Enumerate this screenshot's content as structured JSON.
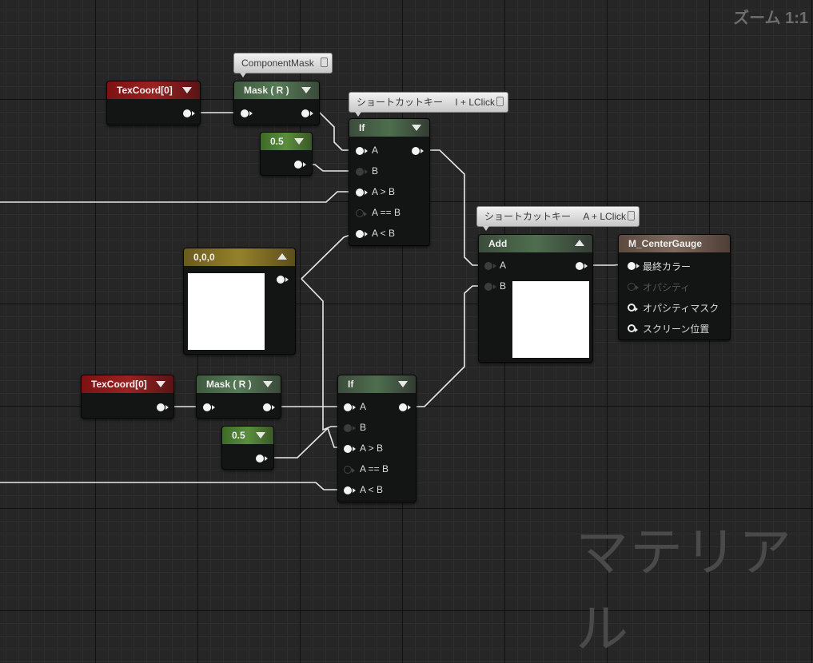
{
  "zoom_label": "ズーム 1:1",
  "watermark": "マテリアル",
  "comments": {
    "component_mask": "ComponentMask",
    "shortcut_if": "ショートカットキー　 I + LClick",
    "shortcut_add": "ショートカットキー　 A + LClick"
  },
  "nodes": {
    "texcoord_top": {
      "title": "TexCoord[0]"
    },
    "mask_top": {
      "title": "Mask ( R )"
    },
    "const_top": {
      "title": "0.5"
    },
    "if_top": {
      "title": "If",
      "pins": [
        "A",
        "B",
        "A > B",
        "A == B",
        "A < B"
      ]
    },
    "vector_const": {
      "title": "0,0,0"
    },
    "add": {
      "title": "Add",
      "pins": [
        "A",
        "B"
      ]
    },
    "material_output": {
      "title": "M_CenterGauge",
      "pins": [
        "最終カラー",
        "オパシティ",
        "オパシティマスク",
        "スクリーン位置"
      ]
    },
    "texcoord_bottom": {
      "title": "TexCoord[0]"
    },
    "mask_bottom": {
      "title": "Mask ( R )"
    },
    "const_bottom": {
      "title": "0.5"
    },
    "if_bottom": {
      "title": "If",
      "pins": [
        "A",
        "B",
        "A > B",
        "A == B",
        "A < B"
      ]
    }
  },
  "colors": {
    "graph_bg": "#262626",
    "wire": "#e8e8e8",
    "texcoord_header": "#8c1a1a",
    "mask_header": "#587a58",
    "constant_header": "#5a8e3e",
    "vector_header": "#94822a",
    "output_header": "#7e6a5e"
  }
}
